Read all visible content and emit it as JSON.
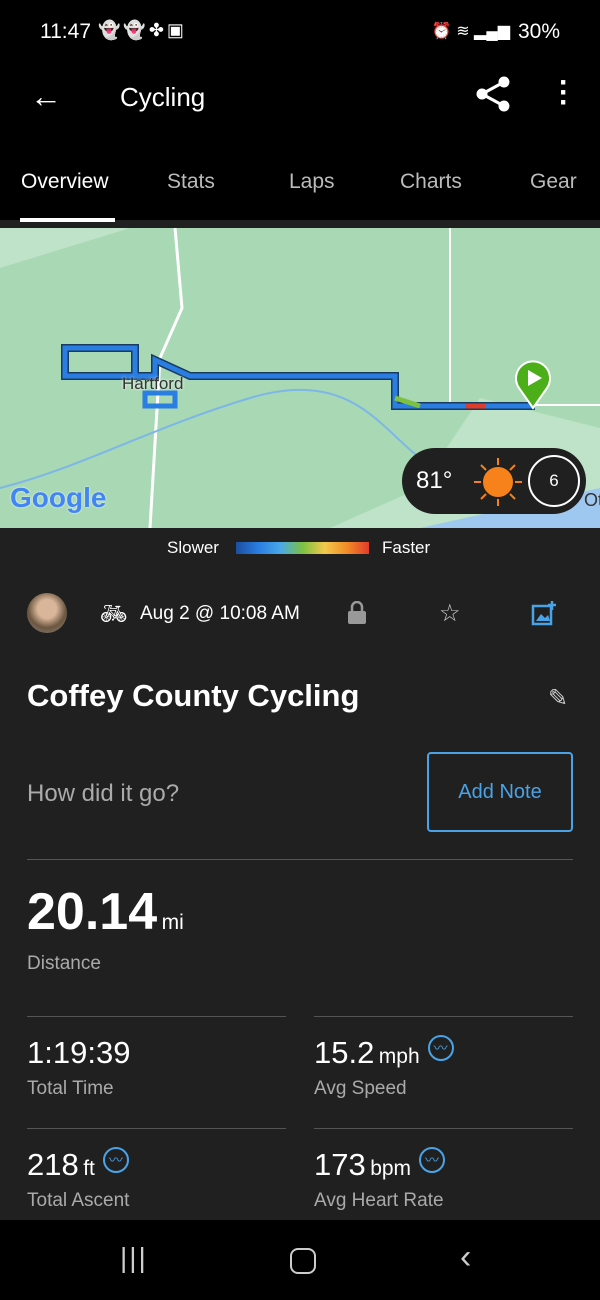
{
  "status_bar": {
    "time": "11:47",
    "notification_icons": [
      "snapchat-icon",
      "snapchat-icon",
      "pinwheel-icon",
      "gallery-icon"
    ],
    "right_icons": [
      "alarm-icon",
      "wifi-icon",
      "signal-icon"
    ],
    "battery": "30%"
  },
  "app_bar": {
    "title": "Cycling"
  },
  "tabs": [
    {
      "label": "Overview",
      "active": true
    },
    {
      "label": "Stats"
    },
    {
      "label": "Laps"
    },
    {
      "label": "Charts"
    },
    {
      "label": "Gear"
    }
  ],
  "map": {
    "town_label": "Hartford",
    "google_logo": "Google",
    "edge_label": "Ot",
    "weather": {
      "temp": "81°",
      "icon": "sun-icon",
      "wind": "6"
    }
  },
  "speed_legend": {
    "slower": "Slower",
    "faster": "Faster"
  },
  "activity": {
    "date": "Aug 2 @ 10:08 AM",
    "name": "Coffey County Cycling",
    "note_prompt": "How did it go?",
    "add_note": "Add Note"
  },
  "stats": {
    "distance": {
      "value": "20.14",
      "unit": "mi",
      "label": "Distance"
    },
    "total_time": {
      "value": "1:19:39",
      "label": "Total Time"
    },
    "avg_speed": {
      "value": "15.2",
      "unit": "mph",
      "label": "Avg Speed"
    },
    "total_ascent": {
      "value": "218",
      "unit": "ft",
      "label": "Total Ascent"
    },
    "avg_hr": {
      "value": "173",
      "unit": "bpm",
      "label": "Avg Heart Rate"
    }
  },
  "colors": {
    "accent": "#4aa3e6",
    "start_pin": "#4caf1a",
    "sun": "#f7821b"
  }
}
